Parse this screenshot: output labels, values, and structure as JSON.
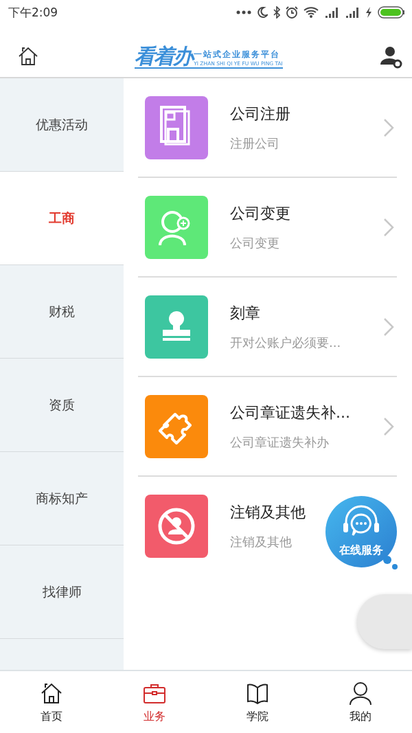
{
  "status_bar": {
    "time": "下午2:09"
  },
  "header": {
    "logo": "看着办",
    "slogan": "一站式企业服务平台",
    "pinyin": "YI ZHAN SHI QI YE FU WU PING TAI"
  },
  "sidebar": {
    "items": [
      {
        "label": "优惠活动",
        "selected": false
      },
      {
        "label": "工商",
        "selected": true
      },
      {
        "label": "财税",
        "selected": false
      },
      {
        "label": "资质",
        "selected": false
      },
      {
        "label": "商标知产",
        "selected": false
      },
      {
        "label": "找律师",
        "selected": false
      }
    ]
  },
  "services": [
    {
      "title": "公司注册",
      "subtitle": "注册公司",
      "color": "#c27de8",
      "kind": "building"
    },
    {
      "title": "公司变更",
      "subtitle": "公司变更",
      "color": "#5ee878",
      "kind": "person"
    },
    {
      "title": "刻章",
      "subtitle": "开对公账户必须要...",
      "color": "#3dc6a0",
      "kind": "stamp"
    },
    {
      "title": "公司章证遗失补...",
      "subtitle": "公司章证遗失补办",
      "color": "#fb8a0c",
      "kind": "puzzle"
    },
    {
      "title": "注销及其他",
      "subtitle": "注销及其他",
      "color": "#f25b6b",
      "kind": "forbidden"
    }
  ],
  "chat_button": {
    "label": "在线服务"
  },
  "tabs": [
    {
      "label": "首页",
      "selected": false,
      "kind": "home"
    },
    {
      "label": "业务",
      "selected": true,
      "kind": "case"
    },
    {
      "label": "学院",
      "selected": false,
      "kind": "book"
    },
    {
      "label": "我的",
      "selected": false,
      "kind": "person"
    }
  ]
}
